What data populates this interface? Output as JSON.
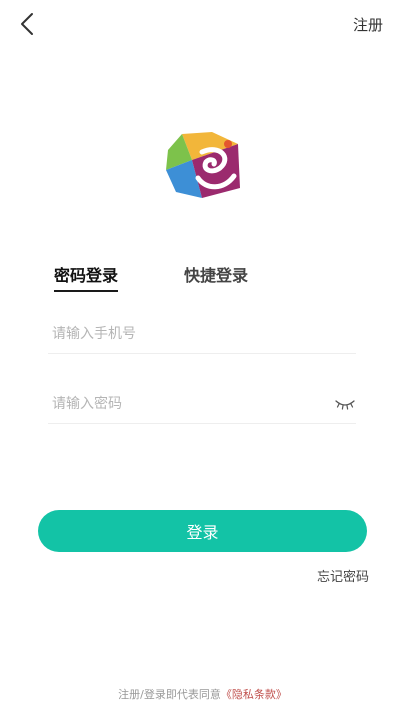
{
  "header": {
    "back_icon": "chevron-left-icon",
    "register_label": "注册"
  },
  "logo": {
    "icon": "app-logo-hexagon"
  },
  "tabs": [
    {
      "label": "密码登录",
      "active": true
    },
    {
      "label": "快捷登录",
      "active": false
    }
  ],
  "form": {
    "phone_placeholder": "请输入手机号",
    "phone_value": "",
    "password_placeholder": "请输入密码",
    "password_value": "",
    "password_toggle_icon": "eye-closed-icon"
  },
  "login_button_label": "登录",
  "forgot_password_label": "忘记密码",
  "footer": {
    "agreement_text": "注册/登录即代表同意",
    "privacy_link_label": "《隐私条款》"
  },
  "colors": {
    "accent": "#13c3a6",
    "privacy_link": "#c0504d"
  }
}
